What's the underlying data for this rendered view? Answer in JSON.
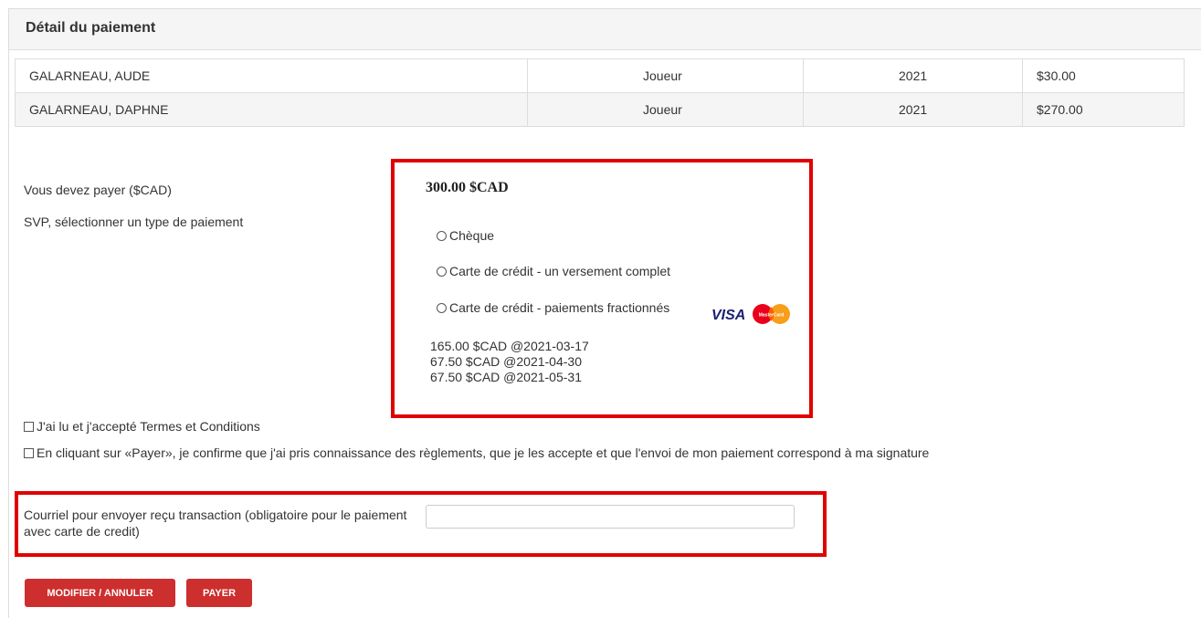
{
  "panel": {
    "title": "Détail du paiement"
  },
  "items": [
    {
      "name": "GALARNEAU, AUDE",
      "role": "Joueur",
      "year": "2021",
      "amount": "$30.00"
    },
    {
      "name": "GALARNEAU, DAPHNE",
      "role": "Joueur",
      "year": "2021",
      "amount": "$270.00"
    }
  ],
  "payment": {
    "due_label": "Vous devez payer ($CAD)",
    "due_amount": "300.00 $CAD",
    "select_label": "SVP, sélectionner un type de paiement",
    "options": [
      {
        "label": "Chèque",
        "selected": false
      },
      {
        "label": "Carte de crédit - un versement complet",
        "selected": false
      },
      {
        "label": "Carte de crédit - paiements fractionnés",
        "selected": false
      }
    ],
    "schedule": [
      "165.00 $CAD @2021-03-17",
      "67.50 $CAD @2021-04-30",
      "67.50 $CAD @2021-05-31"
    ],
    "card_logos": [
      "visa-logo",
      "mastercard-logo"
    ],
    "card_logo_text": {
      "visa": "VISA",
      "mastercard": "MasterCard"
    }
  },
  "agreements": {
    "terms": "J'ai lu et j'accepté Termes et Conditions",
    "confirm": "En cliquant sur «Payer», je confirme que j'ai pris connaissance des règlements, que je les accepte et que l'envoi de mon paiement correspond à ma signature"
  },
  "email": {
    "label": "Courriel pour envoyer reçu transaction (obligatoire pour le paiement avec carte de credit)",
    "value": ""
  },
  "buttons": {
    "modify": "MODIFIER / ANNULER",
    "pay": "PAYER"
  },
  "colors": {
    "highlight_border": "#e00000",
    "button_bg": "#cd2e2e",
    "header_bg": "#f5f5f5"
  }
}
